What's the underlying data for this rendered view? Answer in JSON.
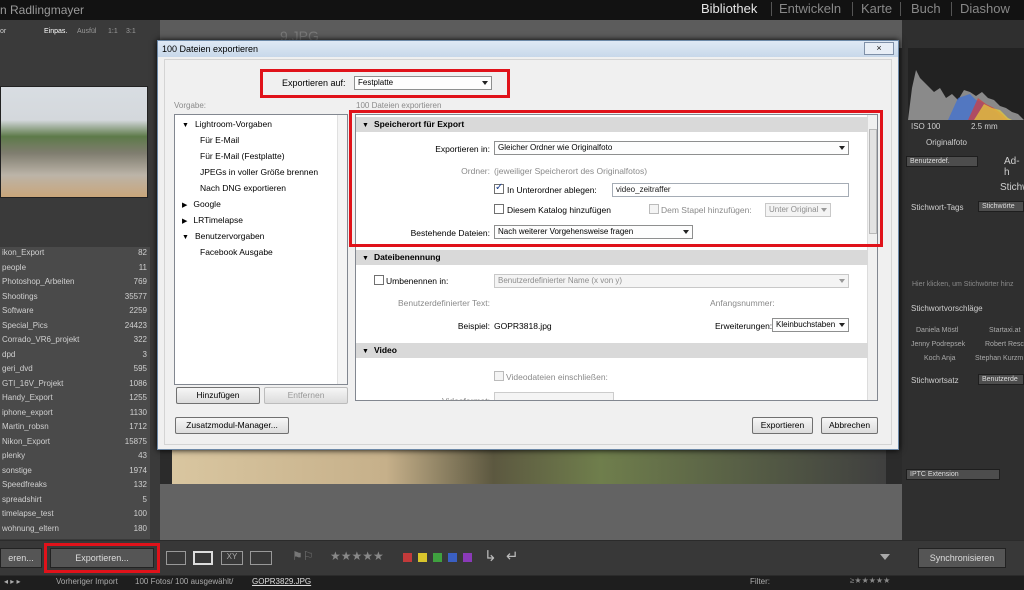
{
  "lightroom": {
    "identity": "n Radlingmayer",
    "modules": [
      "Bibliothek",
      "Entwickeln",
      "Karte",
      "Buch",
      "Diashow"
    ],
    "active_module": "Bibliothek",
    "navigator": {
      "label": "or",
      "fit": "Einpas.",
      "fill": "Ausfül",
      "one": "1:1",
      "three": "3:1"
    },
    "collections": [
      {
        "name": "ikon_Export",
        "count": "82"
      },
      {
        "name": "people",
        "count": "11"
      },
      {
        "name": "Photoshop_Arbeiten",
        "count": "769"
      },
      {
        "name": "Shootings",
        "count": "35577"
      },
      {
        "name": "Software",
        "count": "2259"
      },
      {
        "name": "Special_Pics",
        "count": "24423"
      },
      {
        "name": "Corrado_VR6_projekt",
        "count": "322"
      },
      {
        "name": "dpd",
        "count": "3"
      },
      {
        "name": "geri_dvd",
        "count": "595"
      },
      {
        "name": "GTI_16V_Projekt",
        "count": "1086"
      },
      {
        "name": "Handy_Export",
        "count": "1255"
      },
      {
        "name": "iphone_export",
        "count": "1130"
      },
      {
        "name": "Martin_robsn",
        "count": "1712"
      },
      {
        "name": "Nikon_Export",
        "count": "15875"
      },
      {
        "name": "plenky",
        "count": "43"
      },
      {
        "name": "sonstige",
        "count": "1974"
      },
      {
        "name": "Speedfreaks",
        "count": "132"
      },
      {
        "name": "spreadshirt",
        "count": "5"
      },
      {
        "name": "timelapse_test",
        "count": "100"
      },
      {
        "name": "wohnung_eltern",
        "count": "180"
      }
    ],
    "import_button": "eren...",
    "export_button": "Exportieren...",
    "right": {
      "iso": "ISO 100",
      "focal": "2.5 mm",
      "original": "Originalfoto",
      "preset": "Benutzerdef.",
      "quick": "Ad-h",
      "keywording": "Stichw",
      "keyword_tags": "Stichwort-Tags",
      "keyword_tags_sel": "Stichwörte",
      "keyword_hint": "Hier klicken, um Stichwörter hinz",
      "suggestions": "Stichwortvorschläge",
      "sugg": [
        "Daniela Möstl",
        "Startaxi.at",
        "Jenny Podrepsek",
        "Robert Resc",
        "Koch Anja",
        "Stephan Kurzm"
      ],
      "keyword_set": "Stichwortsatz",
      "keyword_set_sel": "Benutzerde",
      "iptc": "IPTC Extension",
      "sync": "Synchronisieren"
    },
    "status": {
      "prev": "Vorheriger Import",
      "count": "100 Fotos/ 100 ausgewählt/",
      "file": "GOPR3829.JPG",
      "filter": "Filter:"
    },
    "background_filename": "9.JPG"
  },
  "dialog": {
    "title": "100 Dateien exportieren",
    "close": "×",
    "export_to_label": "Exportieren auf:",
    "export_to_value": "Festplatte",
    "preset_label": "Vorgabe:",
    "files_label": "100 Dateien exportieren",
    "presets": [
      {
        "label": "Lightroom-Vorgaben",
        "level": 0,
        "state": "open"
      },
      {
        "label": "Für E-Mail",
        "level": 1
      },
      {
        "label": "Für E-Mail (Festplatte)",
        "level": 1
      },
      {
        "label": "JPEGs in voller Größe brennen",
        "level": 1
      },
      {
        "label": "Nach DNG exportieren",
        "level": 1
      },
      {
        "label": "Google",
        "level": 0,
        "state": "closed"
      },
      {
        "label": "LRTimelapse",
        "level": 0,
        "state": "closed"
      },
      {
        "label": "Benutzervorgaben",
        "level": 0,
        "state": "open"
      },
      {
        "label": "Facebook Ausgabe",
        "level": 1
      }
    ],
    "add_button": "Hinzufügen",
    "remove_button": "Entfernen",
    "plugin_button": "Zusatzmodul-Manager...",
    "export_button": "Exportieren",
    "cancel_button": "Abbrechen",
    "location": {
      "header": "Speicherort für Export",
      "export_in_label": "Exportieren in:",
      "export_in_value": "Gleicher Ordner wie Originalfoto",
      "folder_label": "Ordner:",
      "folder_value": "(jeweiliger Speicherort des Originalfotos)",
      "subfolder_label": "In Unterordner ablegen:",
      "subfolder_value": "video_zeitraffer",
      "catalog_label": "Diesem Katalog hinzufügen",
      "stack_label": "Dem Stapel hinzufügen:",
      "stack_value": "Unter Original",
      "existing_label": "Bestehende Dateien:",
      "existing_value": "Nach weiterer Vorgehensweise fragen"
    },
    "naming": {
      "header": "Dateibenennung",
      "rename_label": "Umbenennen in:",
      "rename_value": "Benutzerdefinierter Name (x von y)",
      "custom_text_label": "Benutzerdefinierter Text:",
      "start_number_label": "Anfangsnummer:",
      "example_label": "Beispiel:",
      "example_value": "GOPR3818.jpg",
      "extensions_label": "Erweiterungen:",
      "extensions_value": "Kleinbuchstaben"
    },
    "video": {
      "header": "Video",
      "include_label": "Videodateien einschließen:",
      "format_label": "Videoformat:"
    }
  },
  "colors": {
    "highlight": "#e0121a",
    "section_header": "#d9d9d9",
    "titlebar": "#c8d8ea"
  }
}
